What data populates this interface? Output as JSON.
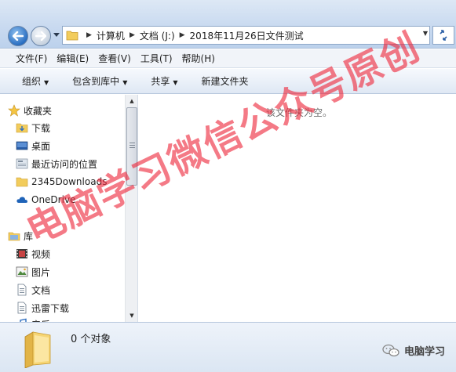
{
  "address": {
    "crumbs": [
      "计算机",
      "文档 (J:)",
      "2018年11月26日文件测试"
    ]
  },
  "menu": [
    "文件(F)",
    "编辑(E)",
    "查看(V)",
    "工具(T)",
    "帮助(H)"
  ],
  "commands": [
    {
      "label": "组织",
      "dropdown": true
    },
    {
      "label": "包含到库中",
      "dropdown": true
    },
    {
      "label": "共享",
      "dropdown": true
    },
    {
      "label": "新建文件夹",
      "dropdown": false
    }
  ],
  "nav": {
    "favorites_header": "收藏夹",
    "favorites": [
      "下载",
      "桌面",
      "最近访问的位置",
      "2345Downloads",
      "OneDrive"
    ],
    "libraries_header": "库",
    "libraries": [
      "视频",
      "图片",
      "文档",
      "迅雷下载",
      "音乐"
    ]
  },
  "content": {
    "empty_message": "该文件夹为空。"
  },
  "details": {
    "item_count": "0 个对象"
  },
  "watermark": {
    "main_text": "电脑学习微信公众号原创",
    "corner_text": "电脑学习"
  },
  "colors": {
    "watermark": "#ee283c",
    "folder": "#f2cc5c",
    "accent": "#2a6fc2"
  }
}
